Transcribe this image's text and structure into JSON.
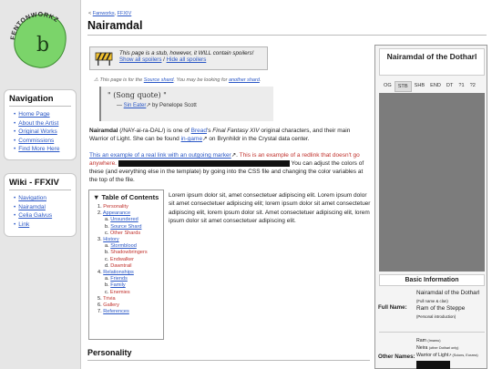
{
  "logo": {
    "text": "FENTONWORKZ",
    "glyph": "b"
  },
  "navigation": {
    "title": "Navigation",
    "items": [
      "Home Page",
      "About the Artist",
      "Original Works",
      "Commissions",
      "Find More Here"
    ]
  },
  "wiki": {
    "title": "Wiki - FFXIV",
    "items": [
      "Navigation",
      "Nairamdal",
      "Celia Galvus",
      "Link"
    ]
  },
  "breadcrumb": {
    "sep1": "< ",
    "item1": "Fanworks",
    "sep2": ", ",
    "item2": "FFXIV"
  },
  "page_title": "Nairamdal",
  "stub": {
    "line1": "This page is a stub, however, it WILL contain spoilers!",
    "show": "Show all spoilers",
    "sep": " / ",
    "hide": "Hide all spoilers"
  },
  "source_note": {
    "pre": "This page is for the ",
    "link1": "Source shard",
    "mid": ". You may be looking for ",
    "link2": "another shard",
    "post": "."
  },
  "quote": {
    "text": "\" (Song quote) \"",
    "dash": "— ",
    "author": "Sin Eater",
    "ext": "↗",
    "by": " by Penelope Scott"
  },
  "intro": {
    "name": "Nairamdal",
    "pron": " (/NAY-ai-ra-DAL/) is one of ",
    "link_bread": "Bread",
    "own": "'s ",
    "game": "Final Fantasy XIV",
    "rest1": " original characters, and their main Warrior of Light. She can be found ",
    "ingame": "in-game",
    "ext": "↗",
    "rest2": " on Brynhildr in the Crystal data center."
  },
  "para2": {
    "link": "This an example of a real link with an outgoing marker",
    "ext": "↗",
    "dot": ".",
    "redlink": " This is an example of a redlink that doesn't go anywhere.",
    "after_bar": " You can adjust the colors of these (and everything else in the template) by going into the CSS file and changing the color variables at the top of the file."
  },
  "toc": {
    "title": "▼ Table of Contents",
    "rows": [
      {
        "num": "1. ",
        "label": "Personality",
        "level": 1,
        "color": "red"
      },
      {
        "num": "2. ",
        "label": "Appearance",
        "level": 1,
        "color": "link"
      },
      {
        "num": "a. ",
        "label": "Unsundered",
        "level": 2,
        "color": "link"
      },
      {
        "num": "b. ",
        "label": "Source Shard",
        "level": 2,
        "color": "link"
      },
      {
        "num": "c. ",
        "label": "Other Shards",
        "level": 2,
        "color": "red"
      },
      {
        "num": "3. ",
        "label": "History",
        "level": 1,
        "color": "link"
      },
      {
        "num": "a. ",
        "label": "Stormblood",
        "level": 2,
        "color": "link"
      },
      {
        "num": "b. ",
        "label": "Shadowbringers",
        "level": 2,
        "color": "red"
      },
      {
        "num": "c. ",
        "label": "Endwalker",
        "level": 2,
        "color": "red"
      },
      {
        "num": "d. ",
        "label": "Dawntrail",
        "level": 2,
        "color": "red"
      },
      {
        "num": "4. ",
        "label": "Relationships",
        "level": 1,
        "color": "link"
      },
      {
        "num": "a. ",
        "label": "Friends",
        "level": 2,
        "color": "link"
      },
      {
        "num": "b. ",
        "label": "Family",
        "level": 2,
        "color": "link"
      },
      {
        "num": "c. ",
        "label": "Enemies",
        "level": 2,
        "color": "red"
      },
      {
        "num": "5. ",
        "label": "Trivia",
        "level": 1,
        "color": "red"
      },
      {
        "num": "6. ",
        "label": "Gallery",
        "level": 1,
        "color": "red"
      },
      {
        "num": "7. ",
        "label": "References",
        "level": 1,
        "color": "link"
      }
    ]
  },
  "lorem": "Lorem ipsum dolor sit, amet consectetuer adipiscing elit. Lorem ipsum dolor sit amet consectetuer adipiscing elit; lorem ipsum dolor sit amet consectetuer adipiscing elit, lorem ipsum dolor sit. Amet consectetuer adipiscing elit, lorem ipsum dolor sit amet consectetuer adipiscing elit.",
  "section_heading": "Personality",
  "infobox": {
    "title": "Nairamdal of the Dotharl",
    "tabs": [
      "OG",
      "STB",
      "SHB",
      "END",
      "DT",
      "?1",
      "?2"
    ],
    "selected_tab": "STB",
    "basic_info": "Basic Information",
    "full_name_label": "Full Name:",
    "full_name": "Nairamdal of the Dotharl",
    "full_name_note": "(Full name & clan)",
    "full_name_alt": "Ram of the Steppe",
    "full_name_alt_note": "(Personal introduction)",
    "other_names_label": "Other Names:",
    "other_names": [
      {
        "name": "Ram",
        "note": "(Imamu)"
      },
      {
        "name": "Neira",
        "note": "(other Dotharl only)"
      },
      {
        "name": "Warrior of Light",
        "note": "↗ (Scions, Eorzea)"
      }
    ]
  },
  "colors": {
    "link": "#2a57c6",
    "redlink": "#c0302b",
    "logo_green": "#7bd46a"
  }
}
